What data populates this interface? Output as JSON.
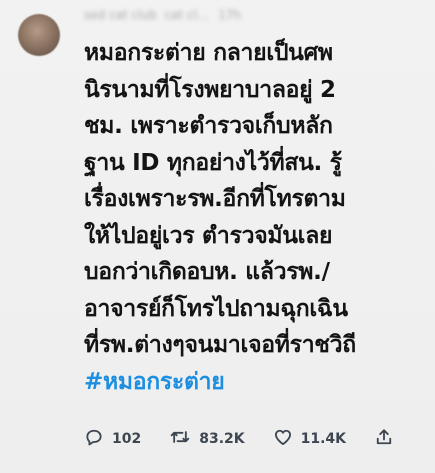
{
  "tweet": {
    "author_name": "sed cat club",
    "author_handle": "cat cl...",
    "timestamp": "17h",
    "body_lines": [
      "หมอกระต่าย กลายเป็นศพ",
      "นิรนามที่โรงพยาบาลอยู่ 2",
      "ชม. เพราะตำรวจเก็บหลัก",
      "ฐาน ID ทุกอย่างไว้ที่สน.  รู้",
      "เรื่องเพราะรพ.อีกที่โทรตาม",
      "ให้ไปอยู่เวร ตำรวจมันเลย",
      "บอกว่าเกิดอบห. แล้วรพ./",
      "อาจารย์ก็โทรไปถามฉุกเฉิน",
      "ที่รพ.ต่างๆจนมาเจอที่ราชวิถี"
    ],
    "hashtag": "#หมอกระต่าย",
    "replies": "102",
    "retweets": "83.2K",
    "likes": "11.4K"
  },
  "icons": [
    "reply-icon",
    "retweet-icon",
    "like-icon",
    "share-icon"
  ],
  "colors": {
    "background": "#eeeeee",
    "text": "#141414",
    "hashtag": "#1d8fe0",
    "action": "#3d4651"
  }
}
